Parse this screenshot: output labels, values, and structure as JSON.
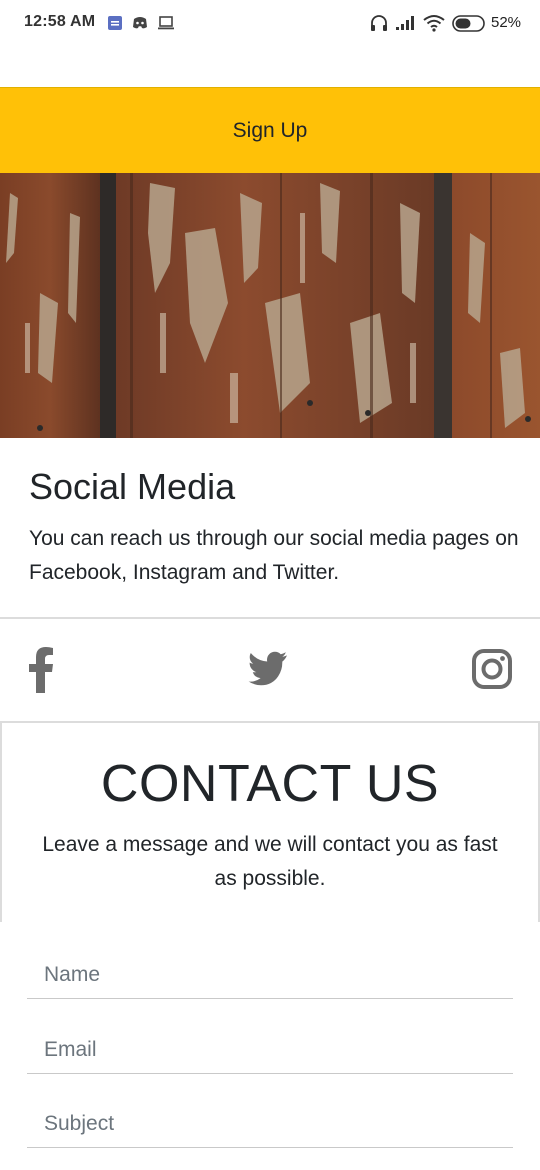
{
  "status_bar": {
    "time": "12:58 AM",
    "battery": "52%",
    "icons": [
      "calendar-icon",
      "discord-icon",
      "laptop-icon",
      "headphones-icon",
      "signal-icon",
      "wifi-icon",
      "battery-icon"
    ]
  },
  "signup": {
    "label": "Sign Up",
    "color": "#ffc107"
  },
  "social_media": {
    "title": "Social Media",
    "description": "You can reach us through our social media pages on Facebook, Instagram and Twitter.",
    "icons": [
      "facebook-icon",
      "twitter-icon",
      "instagram-icon"
    ]
  },
  "contact": {
    "title": "CONTACT US",
    "description": "Leave a message and we will contact you as fast as possible.",
    "fields": {
      "name_placeholder": "Name",
      "email_placeholder": "Email",
      "subject_placeholder": "Subject"
    }
  },
  "colors": {
    "accent": "#ffc107",
    "text": "#212529",
    "icon": "#6c6c6c"
  }
}
